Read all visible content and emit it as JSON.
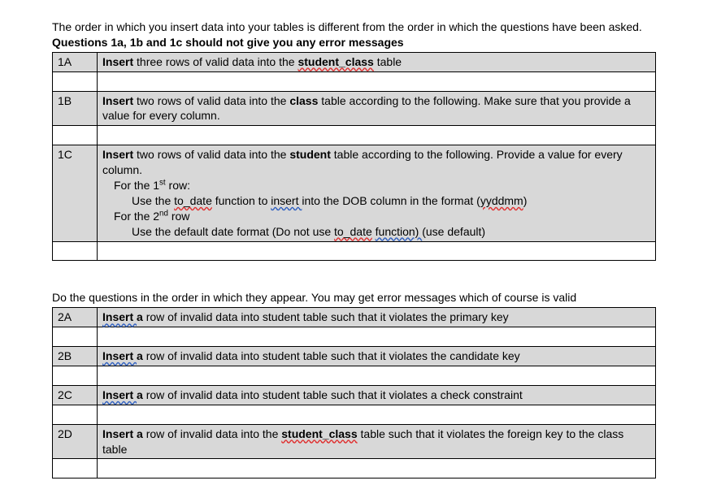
{
  "intro1_a": "The order in which you insert data into your tables is different from the order in which the questions have been asked. ",
  "intro1_b": "Questions 1a, 1b and 1c should not give you any error messages",
  "q1": [
    {
      "num": "1A",
      "html": "<b>Insert</b> three rows of valid data into the <b><span class='sqred'>student_class</span></b> table"
    },
    {
      "num": "1B",
      "html": "<b>Insert</b> two rows of valid data into the <b>class</b> table according to the following. Make sure that you provide a value for every column."
    },
    {
      "num": "1C",
      "html": "<b>Insert</b> two rows of valid data into the <b>student</b> table according to the following. Provide a value for every column.<br><span class='indent1'>For the 1<sup>st</sup> row:</span><br><span class='indent2'>Use the <span class='sqred'>to_date</span> function to <span class='sqblue'>insert </span>into the DOB column in the format (<span class='sqred'>yyddmm</span>)</span><br><span class='indent1'>For the 2<sup>nd</sup> row</span><br><span class='indent2'>Use the default date format (Do not use <span class='sqred'>to_date</span> <span class='sqblue'>function)  </span>(use default)</span>"
    }
  ],
  "intro2": "Do the questions in the order in which they appear. You may get error messages which of course is valid",
  "q2": [
    {
      "num": "2A",
      "html": "<b><span class='sqblue'>Insert </span>a</b> row of invalid data into student table such that it violates the primary key"
    },
    {
      "num": "2B",
      "html": "<b><span class='sqblue'>Insert </span>a</b> row of invalid data into student table such that it violates the candidate key"
    },
    {
      "num": "2C",
      "html": "<b><span class='sqblue'>Insert </span>a</b> row of invalid data into student table such that it violates a check constraint"
    },
    {
      "num": "2D",
      "html": "<b>Insert a</b> row of invalid data into the <b><span class='sqred'>student_class</span></b> table such that it violates the foreign key to the class table"
    }
  ]
}
